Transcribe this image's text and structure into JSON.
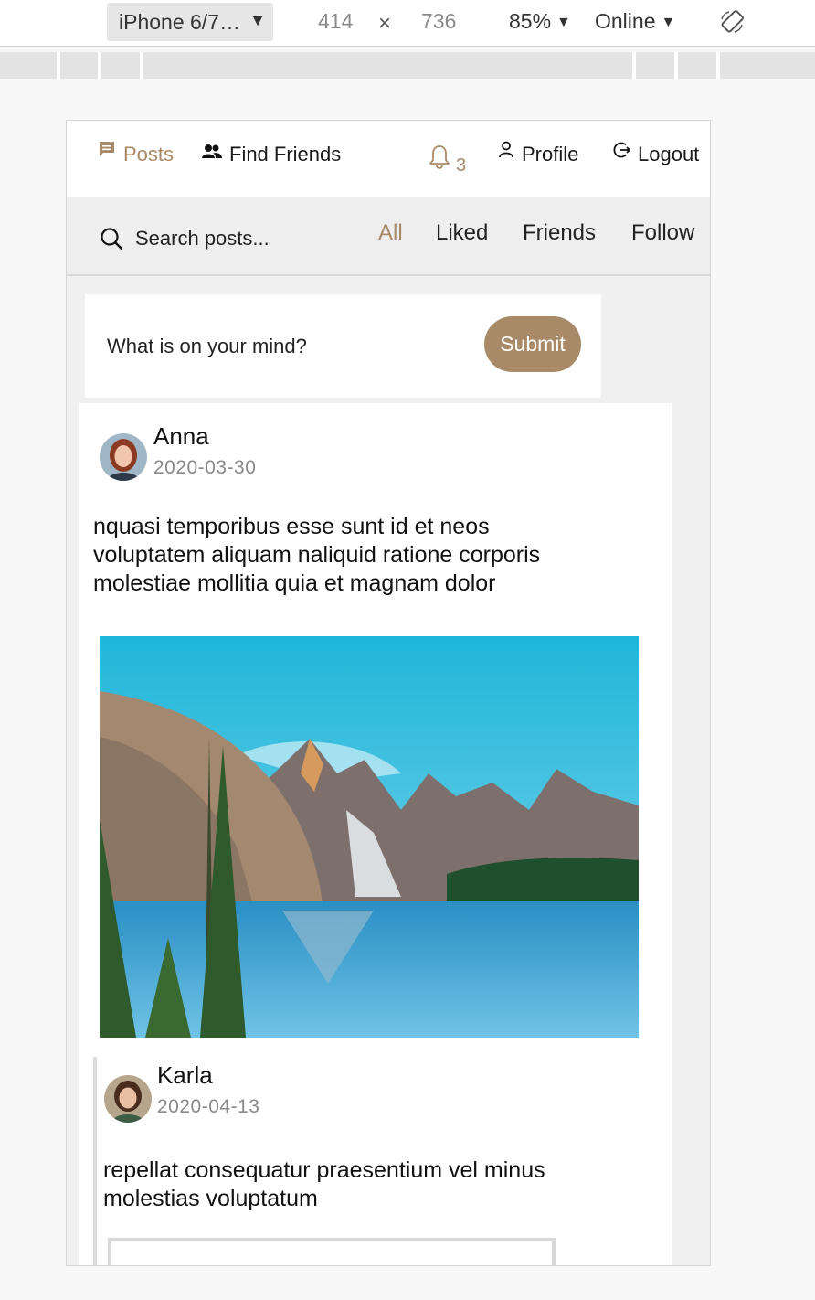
{
  "devtools": {
    "device": "iPhone 6/7…",
    "width": "414",
    "times": "×",
    "height": "736",
    "zoom": "85%",
    "network": "Online"
  },
  "nav": {
    "posts": "Posts",
    "find_friends": "Find Friends",
    "notifications_count": "3",
    "profile": "Profile",
    "logout": "Logout"
  },
  "filter": {
    "search_placeholder": "Search posts...",
    "tabs": [
      "All",
      "Liked",
      "Friends",
      "Follow"
    ]
  },
  "composer": {
    "placeholder": "What is on your mind?",
    "submit": "Submit"
  },
  "posts": [
    {
      "author": "Anna",
      "date": "2020-03-30",
      "text_lines": [
        "nquasi temporibus esse sunt id et neos",
        "voluptatem aliquam naliquid ratione corporis",
        "molestiae mollitia quia et magnam dolor"
      ]
    },
    {
      "author": "Karla",
      "date": "2020-04-13",
      "text_lines": [
        "repellat consequatur praesentium vel minus",
        "molestias voluptatum"
      ]
    }
  ],
  "colors": {
    "accent": "#a98a68",
    "page_bg": "#f1f0f0",
    "card_bg": "#ffffff"
  },
  "icons": {
    "posts": "chat-bubble-icon",
    "find_friends": "people-icon",
    "notifications": "bell-icon",
    "profile": "user-icon",
    "logout": "logout-icon",
    "search": "search-icon",
    "rotate": "rotate-device-icon"
  }
}
